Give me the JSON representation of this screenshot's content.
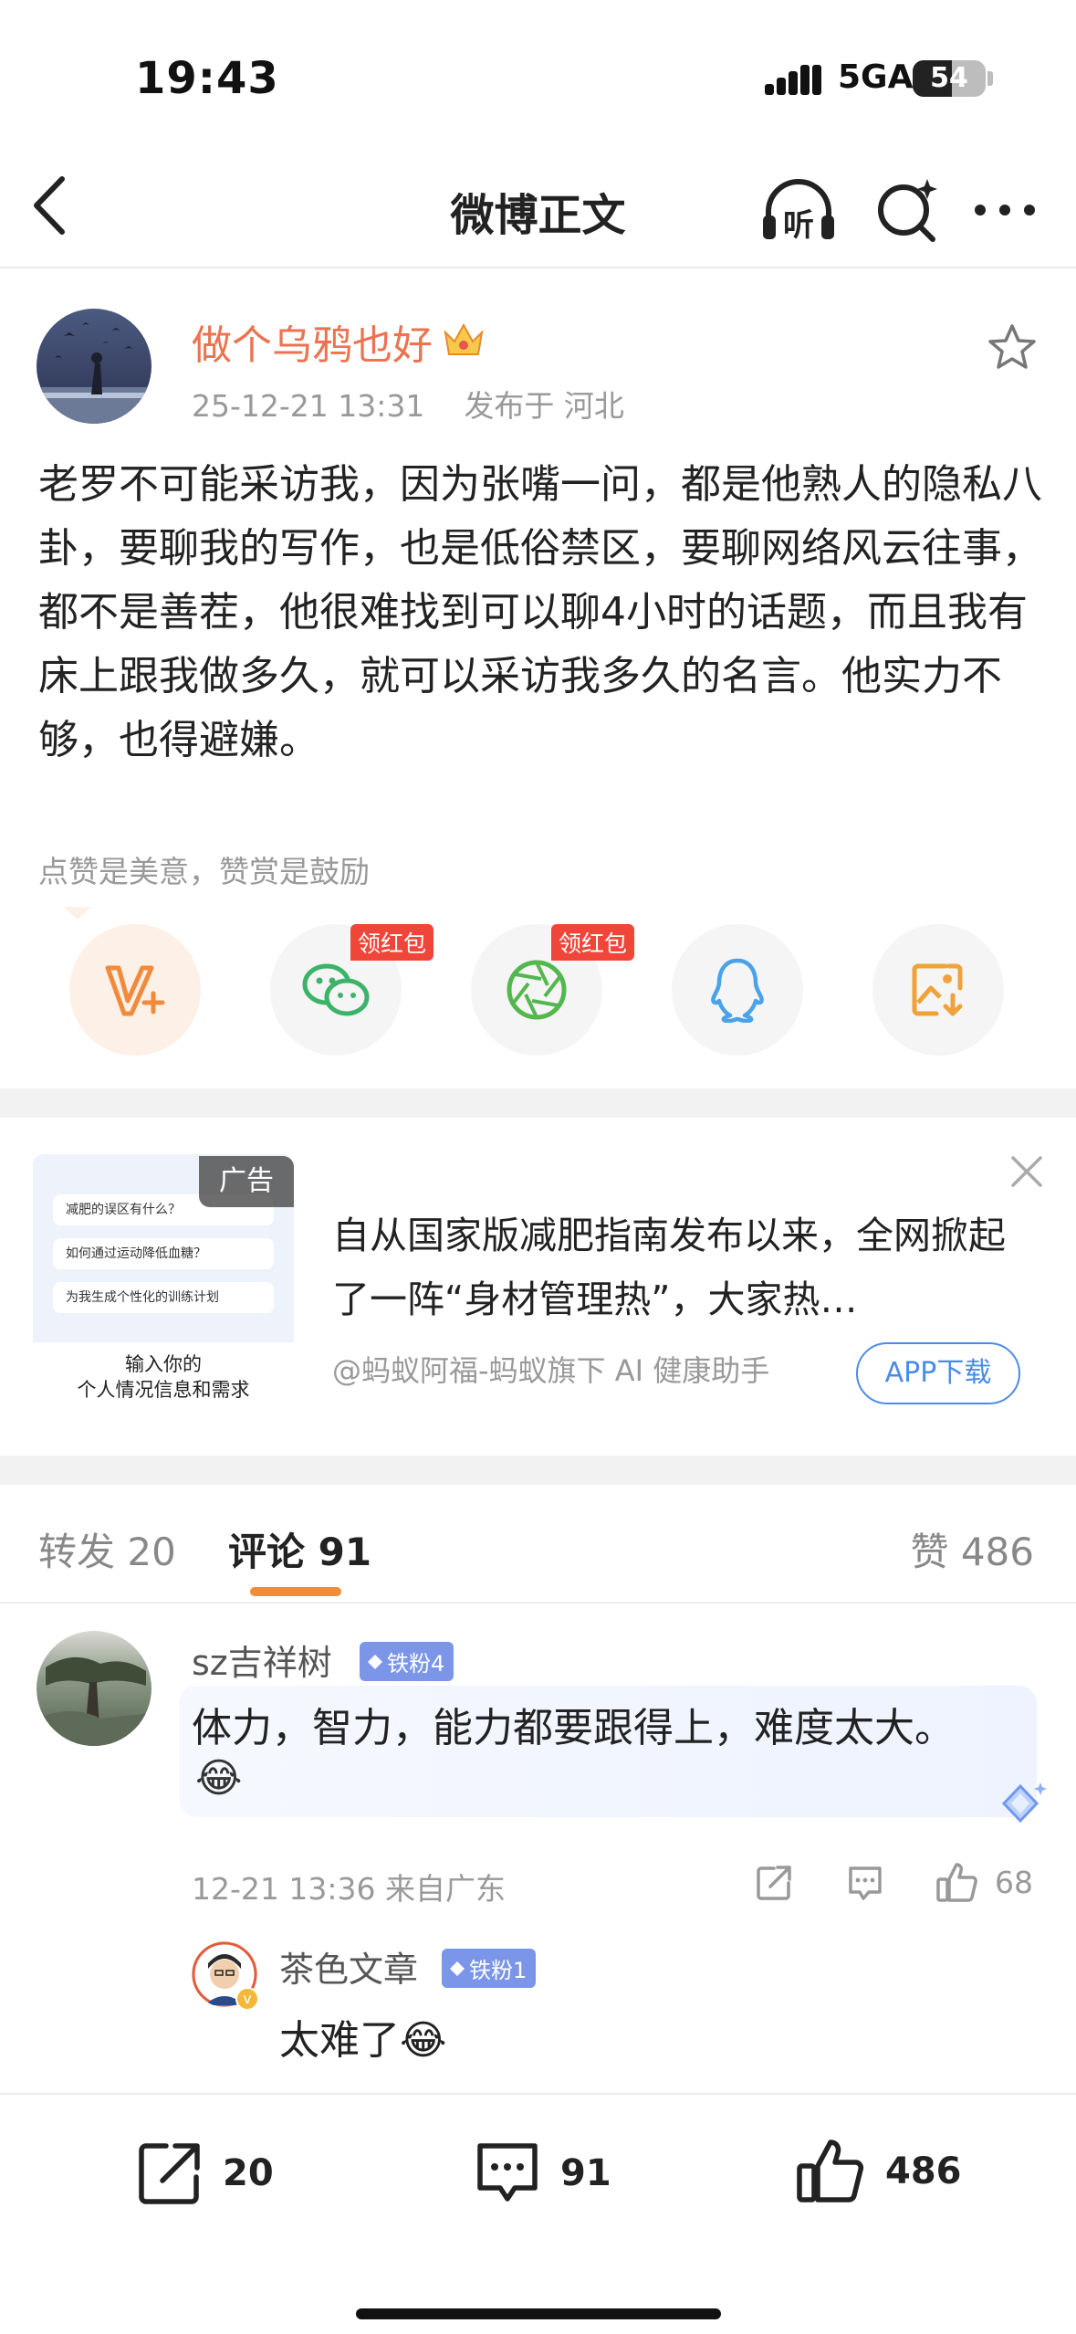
{
  "status_bar": {
    "time": "19:43",
    "network": "5GA",
    "battery": "54",
    "battery_level": 0.54
  },
  "nav": {
    "title": "微博正文",
    "listen_label": "听"
  },
  "post": {
    "author": "做个乌鸦也好",
    "time": "25-12-21 13:31",
    "location": "发布于 河北",
    "body": "老罗不可能采访我，因为张嘴一问，都是他熟人的隐私八卦，要聊我的写作，也是低俗禁区，要聊网络风云往事，都不是善茬，他很难找到可以聊4小时的话题，而且我有床上跟我做多久，就可以采访我多久的名言。他实力不够，也得避嫌。",
    "praise_tip": "点赞是美意，赞赏是鼓励",
    "red_packet_tag": "领红包"
  },
  "ad": {
    "tag": "广告",
    "text": "自从国家版减肥指南发布以来，全网掀起了一阵“身材管理热”，大家热…",
    "source": "@蚂蚁阿福-蚂蚁旗下 AI 健康助手",
    "button": "APP下载",
    "image_questions": [
      "减肥的误区有什么？",
      "如何通过运动降低血糖？",
      "为我生成个性化的训练计划"
    ],
    "image_caption_1": "输入你的",
    "image_caption_2": "个人情况信息和需求"
  },
  "tabs": {
    "repost": "转发 20",
    "comments": "评论 91",
    "likes": "赞 486"
  },
  "comments": [
    {
      "user": "sz吉祥树",
      "badge": "铁粉4",
      "text": "体力，智力，能力都要跟得上，难度太大。",
      "emoji": "😂",
      "meta": "12-21 13:36 来自广东",
      "likes": "68",
      "reply": {
        "user": "茶色文章",
        "badge": "铁粉1",
        "text": "太难了😂"
      }
    }
  ],
  "bottom_bar": {
    "reposts": "20",
    "comments": "91",
    "likes": "486"
  },
  "colors": {
    "accent": "#eb7350",
    "tab_underline": "#f28c38",
    "fan_badge": "#7b95e8",
    "red_tag": "#f0463a",
    "link_blue": "#4b8be8"
  }
}
